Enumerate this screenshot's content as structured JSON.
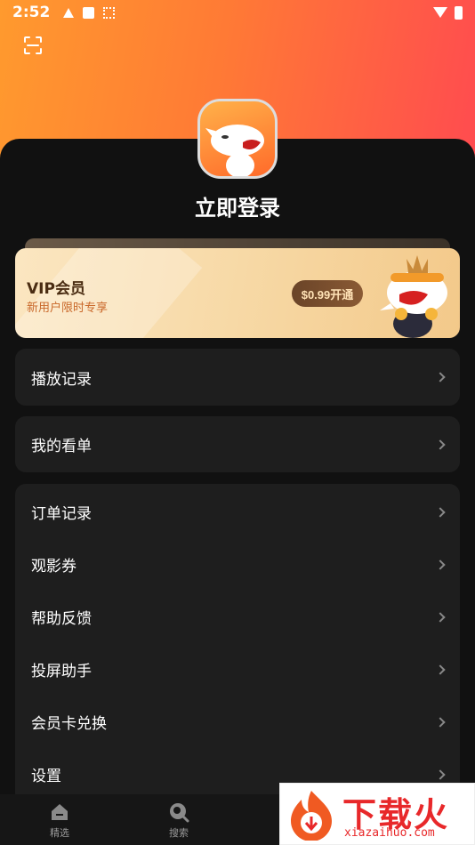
{
  "status_bar": {
    "time": "2:52"
  },
  "profile": {
    "login_label": "立即登录"
  },
  "vip": {
    "title": "VIP会员",
    "subtitle": "新用户限时专享",
    "button_label": "$0.99开通"
  },
  "menu_group_1": [
    {
      "label": "播放记录"
    }
  ],
  "menu_group_2": [
    {
      "label": "我的看单"
    }
  ],
  "menu_group_3": [
    {
      "label": "订单记录"
    },
    {
      "label": "观影券"
    },
    {
      "label": "帮助反馈"
    },
    {
      "label": "投屏助手"
    },
    {
      "label": "会员卡兑换"
    },
    {
      "label": "设置"
    }
  ],
  "bottom_nav": [
    {
      "label": "精选",
      "icon": "home-icon"
    },
    {
      "label": "搜索",
      "icon": "search-icon"
    }
  ],
  "watermark": {
    "title": "下载火",
    "url": "xiazaihuo.com"
  },
  "colors": {
    "accent_orange": "#ff7a35",
    "accent_red": "#ff4a50",
    "vip_gold": "#f7d9a6"
  }
}
